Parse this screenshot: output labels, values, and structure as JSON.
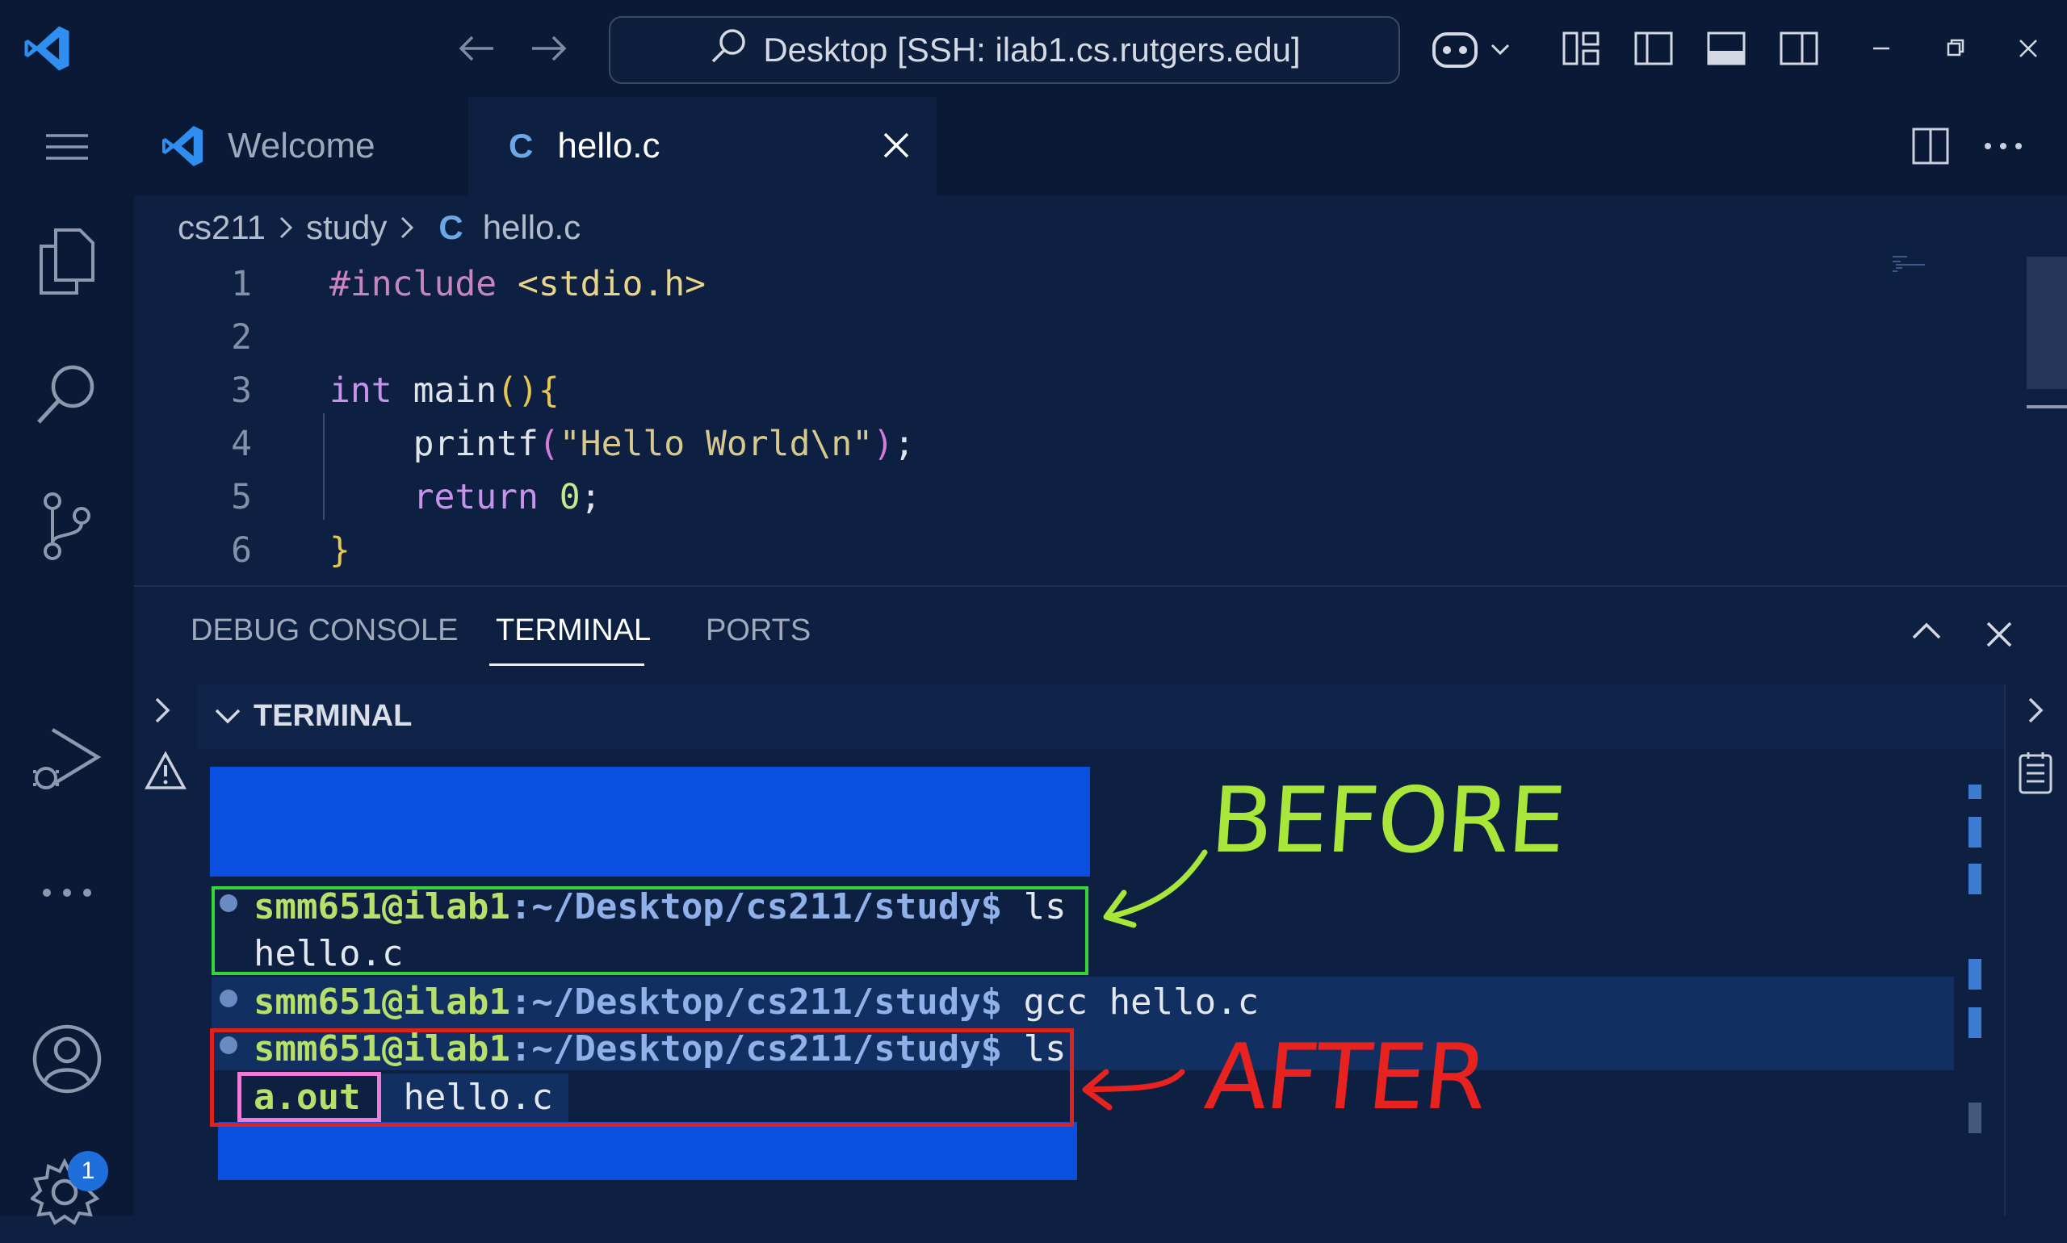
{
  "titlebar": {
    "search_text": "Desktop [SSH: ilab1.cs.rutgers.edu]"
  },
  "tabs": [
    {
      "label": "Welcome"
    },
    {
      "label": "hello.c",
      "icon_letter": "C"
    }
  ],
  "breadcrumb": [
    "cs211",
    "study",
    "hello.c"
  ],
  "breadcrumb_icon_letter": "C",
  "editor": {
    "line_numbers": [
      "1",
      "2",
      "3",
      "4",
      "5",
      "6"
    ],
    "lines": {
      "l1_kw": "#include",
      "l1_hdr": "<stdio.h>",
      "l3_kw": "int",
      "l3_fn": "main",
      "l3_paren": "()",
      "l3_brace": "{",
      "l4_fn": "printf",
      "l4_open": "(",
      "l4_str": "\"Hello World\\n\"",
      "l4_close": ")",
      "l4_semi": ";",
      "l5_kw": "return",
      "l5_num": "0",
      "l5_semi": ";",
      "l6_brace": "}"
    }
  },
  "panel": {
    "tabs": [
      "DEBUG CONSOLE",
      "TERMINAL",
      "PORTS"
    ],
    "active_tab": "TERMINAL",
    "section_title": "TERMINAL"
  },
  "terminal": {
    "prompt_user": "smm651@ilab1",
    "prompt_path": ":~/Desktop/cs211/study$",
    "cmd1": " ls",
    "out1": "hello.c",
    "cmd2": " gcc hello.c",
    "cmd3": " ls",
    "out3_a": "a.out",
    "out3_b": "hello.c"
  },
  "annotations": {
    "before": "BEFORE",
    "after": "AFTER",
    "before_color": "#a8e63a",
    "after_color": "#e8231f",
    "box_green": "#35d43a",
    "box_red": "#e0221c",
    "box_pink": "#f07ad8"
  },
  "badges": {
    "settings_count": "1"
  },
  "colors": {
    "background": "#0d2042",
    "chrome": "#0a1a36",
    "highlight_blue": "#0a4fe0"
  }
}
